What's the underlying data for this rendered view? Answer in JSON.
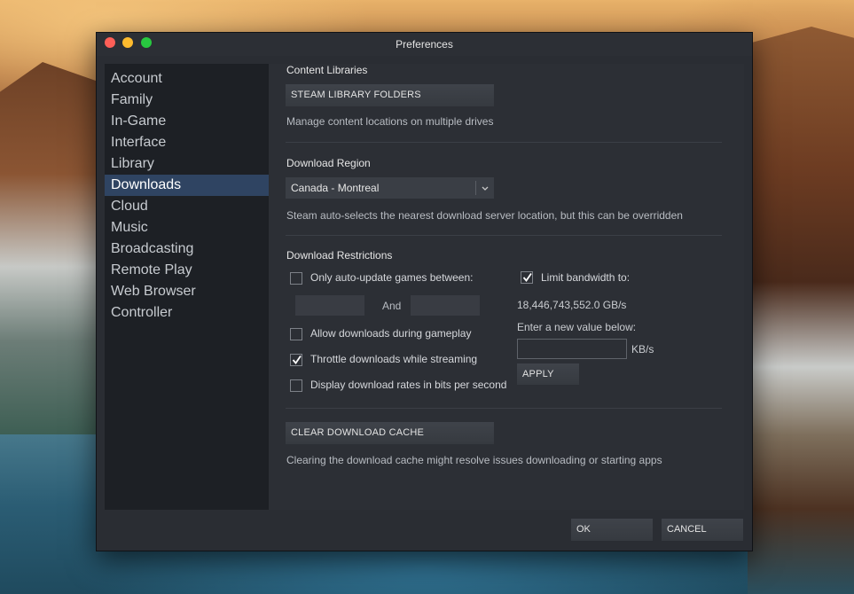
{
  "window": {
    "title": "Preferences"
  },
  "sidebar": {
    "items": [
      {
        "label": "Account"
      },
      {
        "label": "Family"
      },
      {
        "label": "In-Game"
      },
      {
        "label": "Interface"
      },
      {
        "label": "Library"
      },
      {
        "label": "Downloads",
        "active": true
      },
      {
        "label": "Cloud"
      },
      {
        "label": "Music"
      },
      {
        "label": "Broadcasting"
      },
      {
        "label": "Remote Play"
      },
      {
        "label": "Web Browser"
      },
      {
        "label": "Controller"
      }
    ]
  },
  "content_libraries": {
    "heading": "Content Libraries",
    "button": "STEAM LIBRARY FOLDERS",
    "description": "Manage content locations on multiple drives"
  },
  "download_region": {
    "heading": "Download Region",
    "selected": "Canada - Montreal",
    "description": "Steam auto-selects the nearest download server location, but this can be overridden"
  },
  "download_restrictions": {
    "heading": "Download Restrictions",
    "auto_update": {
      "label": "Only auto-update games between:",
      "checked": false
    },
    "and_label": "And",
    "allow_during_gameplay": {
      "label": "Allow downloads during gameplay",
      "checked": false
    },
    "throttle_streaming": {
      "label": "Throttle downloads while streaming",
      "checked": true
    },
    "bits_per_second": {
      "label": "Display download rates in bits per second",
      "checked": false
    },
    "limit_bandwidth": {
      "label": "Limit bandwidth to:",
      "checked": true
    },
    "bandwidth_value": "18,446,743,552.0 GB/s",
    "new_value_label": "Enter a new value below:",
    "unit": "KB/s",
    "apply_button": "APPLY"
  },
  "cache": {
    "button": "CLEAR DOWNLOAD CACHE",
    "description": "Clearing the download cache might resolve issues downloading or starting apps"
  },
  "footer": {
    "ok": "OK",
    "cancel": "CANCEL"
  }
}
